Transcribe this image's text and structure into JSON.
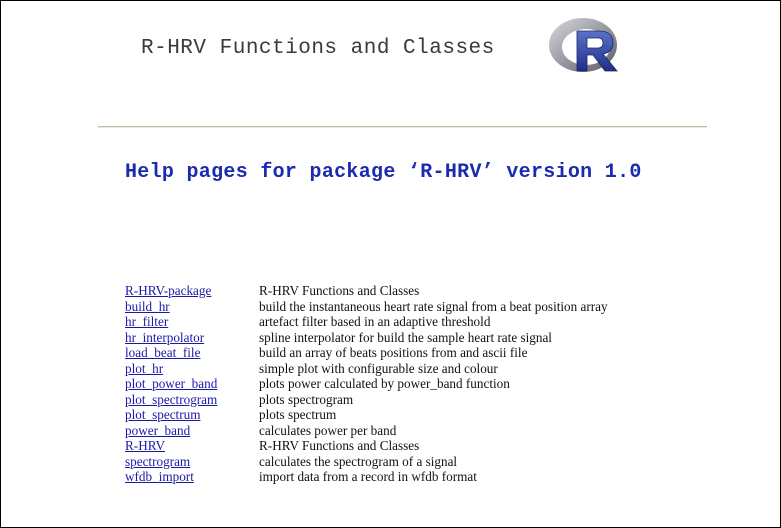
{
  "header": {
    "title": "R-HRV Functions and Classes",
    "logo_letter": "R"
  },
  "main": {
    "heading": "Help pages for package ‘R-HRV’ version 1.0"
  },
  "functions": [
    {
      "name": "R-HRV-package",
      "description": "R-HRV Functions and Classes"
    },
    {
      "name": "build_hr",
      "description": "build the instantaneous heart rate signal from a beat position array"
    },
    {
      "name": "hr_filter",
      "description": "artefact filter based in an adaptive threshold"
    },
    {
      "name": "hr_interpolator",
      "description": "spline interpolator for build the sample heart rate signal"
    },
    {
      "name": "load_beat_file",
      "description": "build an array of beats positions from and ascii file"
    },
    {
      "name": "plot_hr",
      "description": "simple plot with configurable size and colour"
    },
    {
      "name": "plot_power_band",
      "description": "plots power calculated by power_band function"
    },
    {
      "name": "plot_spectrogram",
      "description": "plots spectrogram"
    },
    {
      "name": "plot_spectrum",
      "description": "plots spectrum"
    },
    {
      "name": "power_band",
      "description": "calculates power per band"
    },
    {
      "name": "R-HRV",
      "description": "R-HRV Functions and Classes"
    },
    {
      "name": "spectrogram",
      "description": "calculates the spectrogram of a signal"
    },
    {
      "name": "wfdb_import",
      "description": "import data from a record in wfdb format"
    }
  ],
  "colors": {
    "heading": "#1b2bb0",
    "link": "#1a1aa6",
    "logo_blue": "#2b3f9e",
    "logo_ring": "#9a9aa2"
  }
}
